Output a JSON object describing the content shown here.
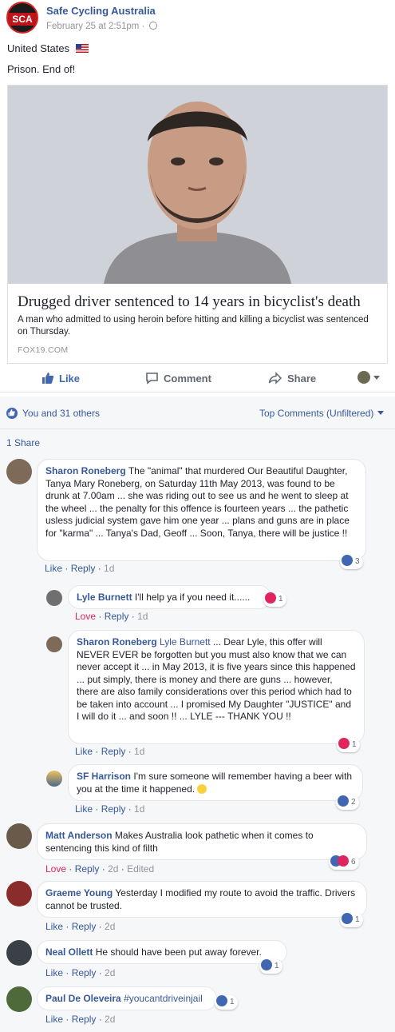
{
  "post": {
    "page_name": "Safe Cycling Australia",
    "page_avatar_text": "SCA",
    "timestamp": "February 25 at 2:51pm",
    "separator": "·",
    "location": "United States",
    "text": "Prison. End of!"
  },
  "link_card": {
    "headline": "Drugged driver sentenced to 14 years in bicyclist's death",
    "description": "A man who admitted to using heroin before hitting and killing a bicyclist was sentenced on Thursday.",
    "source": "FOX19.COM"
  },
  "actions": {
    "like": "Like",
    "comment": "Comment",
    "share": "Share"
  },
  "reactions": {
    "summary": "You and 31 others",
    "sort": "Top Comments (Unfiltered)"
  },
  "shares": "1 Share",
  "comments": [
    {
      "author": "Sharon Roneberg",
      "text": "The \"animal\" that murdered Our Beautiful Daughter, Tanya Mary Roneberg, on Saturday 11th May 2013, was found to be drunk at 7.00am ... she was riding out to see us and he went to sleep at the wheel ... the penalty for this offence is fourteen years ... the pathetic usless judicial system gave him one year ... plans and guns are in place for \"karma\" ... Tanya's Dad, Geoff ... Soon, Tanya, there will be justice !!",
      "action": "Like",
      "reply": "Reply",
      "age": "1d",
      "reaction_count": "3"
    },
    {
      "author": "Lyle Burnett",
      "text": "I'll help ya if you need it......",
      "action": "Love",
      "reply": "Reply",
      "age": "1d",
      "reaction_count": "1"
    },
    {
      "author": "Sharon Roneberg",
      "tag": "Lyle Burnett",
      "text": "... Dear Lyle, this offer will NEVER EVER be forgotten but you must also know that we can never accept it ... in May 2013, it is five years since this happened ... put simply, there is money and there are guns ... however, there are also family considerations over this period which had to be taken into account ... I promised My Daughter \"JUSTICE\" and I will do it ... and soon !! ... LYLE --- THANK YOU !!",
      "action": "Like",
      "reply": "Reply",
      "age": "1d",
      "reaction_count": "1"
    },
    {
      "author": "SF Harrison",
      "text": "I'm sure someone will remember having a beer with you at the time it happened.",
      "action": "Like",
      "reply": "Reply",
      "age": "1d",
      "reaction_count": "2"
    },
    {
      "author": "Matt Anderson",
      "text": "Makes Australia look pathetic when it comes to sentencing this kind of filth",
      "action": "Love",
      "reply": "Reply",
      "age": "2d",
      "edited": "Edited",
      "reaction_count": "6"
    },
    {
      "author": "Graeme Young",
      "text": "Yesterday I modified my route to avoid the traffic. Drivers cannot be trusted.",
      "action": "Like",
      "reply": "Reply",
      "age": "2d",
      "reaction_count": "1"
    },
    {
      "author": "Neal Ollett",
      "text": "He should have been put away forever.",
      "action": "Like",
      "reply": "Reply",
      "age": "2d",
      "reaction_count": "1"
    },
    {
      "author": "Paul De Oleveira",
      "tag": "#youcantdriveinjail",
      "action": "Like",
      "reply": "Reply",
      "age": "2d",
      "reaction_count": "1"
    }
  ],
  "colors": {
    "link": "#365899",
    "like": "#4267b2",
    "love": "#e0245e",
    "muted": "#90949c"
  }
}
